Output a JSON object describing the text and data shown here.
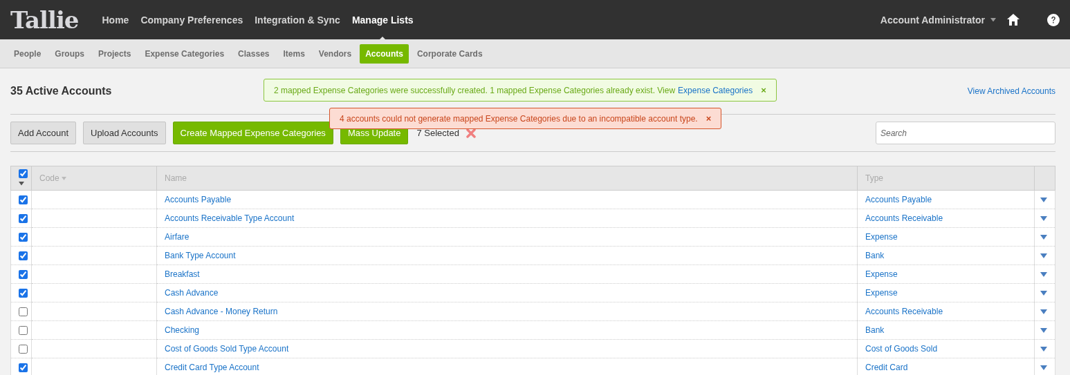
{
  "topbar": {
    "logo": "Tallie",
    "nav": [
      {
        "label": "Home",
        "selected": false
      },
      {
        "label": "Company Preferences",
        "selected": false
      },
      {
        "label": "Integration & Sync",
        "selected": false
      },
      {
        "label": "Manage Lists",
        "selected": true
      }
    ],
    "user": "Account Administrator"
  },
  "subnav": [
    {
      "label": "People",
      "selected": false
    },
    {
      "label": "Groups",
      "selected": false
    },
    {
      "label": "Projects",
      "selected": false
    },
    {
      "label": "Expense Categories",
      "selected": false
    },
    {
      "label": "Classes",
      "selected": false
    },
    {
      "label": "Items",
      "selected": false
    },
    {
      "label": "Vendors",
      "selected": false
    },
    {
      "label": "Accounts",
      "selected": true
    },
    {
      "label": "Corporate Cards",
      "selected": false
    }
  ],
  "title": "35 Active Accounts",
  "archived_link": "View Archived Accounts",
  "alerts": [
    {
      "kind": "success",
      "text": "2 mapped Expense Categories were successfully created. 1 mapped Expense Categories already exist. View",
      "link": "Expense Categories",
      "close": "×"
    },
    {
      "kind": "error",
      "text": "4 accounts could not generate mapped Expense Categories due to an incompatible account type.",
      "close": "×"
    }
  ],
  "toolbar": {
    "buttons": [
      {
        "label": "Add Account",
        "kind": "plain"
      },
      {
        "label": "Upload Accounts",
        "kind": "plain"
      },
      {
        "label": "Create Mapped Expense Categories",
        "kind": "primary"
      },
      {
        "label": "Mass Update",
        "kind": "primary"
      }
    ],
    "selected_count": "7 Selected",
    "search": {
      "placeholder": "Search"
    }
  },
  "table": {
    "all_checked": true,
    "columns": [
      "Code",
      "Name",
      "Type"
    ],
    "rows": [
      {
        "checked": true,
        "name": "Accounts Payable",
        "type": "Accounts Payable"
      },
      {
        "checked": true,
        "name": "Accounts Receivable Type Account",
        "type": "Accounts Receivable"
      },
      {
        "checked": true,
        "name": "Airfare",
        "type": "Expense"
      },
      {
        "checked": true,
        "name": "Bank Type Account",
        "type": "Bank"
      },
      {
        "checked": true,
        "name": "Breakfast",
        "type": "Expense"
      },
      {
        "checked": true,
        "name": "Cash Advance",
        "type": "Expense"
      },
      {
        "checked": false,
        "name": "Cash Advance - Money Return",
        "type": "Accounts Receivable"
      },
      {
        "checked": false,
        "name": "Checking",
        "type": "Bank"
      },
      {
        "checked": false,
        "name": "Cost of Goods Sold Type Account",
        "type": "Cost of Goods Sold"
      },
      {
        "checked": true,
        "name": "Credit Card Type Account",
        "type": "Credit Card"
      }
    ]
  }
}
